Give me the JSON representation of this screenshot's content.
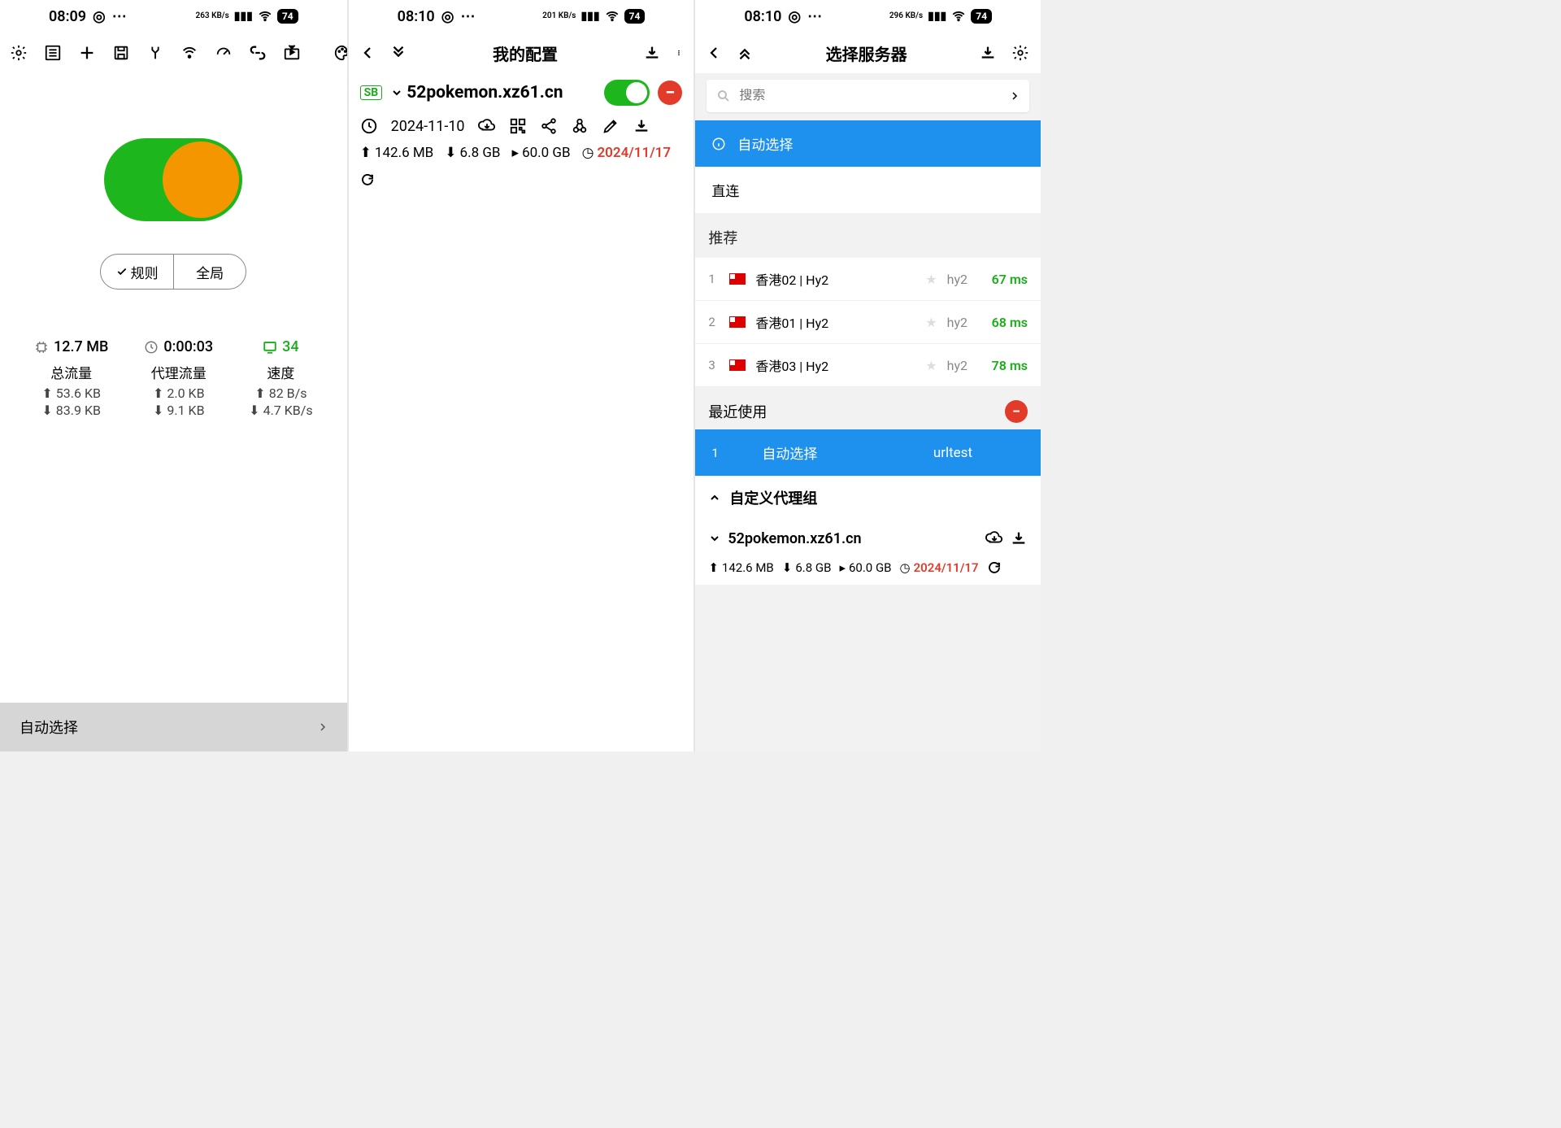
{
  "status": {
    "p1": {
      "time": "08:09",
      "speed": "263\nKB/s",
      "battery": "74"
    },
    "p2": {
      "time": "08:10",
      "speed": "201\nKB/s",
      "battery": "74"
    },
    "p3": {
      "time": "08:10",
      "speed": "296\nKB/s",
      "battery": "74"
    }
  },
  "p1": {
    "rule_label": "规则",
    "global_label": "全局",
    "mem": "12.7 MB",
    "duration": "0:00:03",
    "conns": "34",
    "total_label": "总流量",
    "proxy_label": "代理流量",
    "speed_label": "速度",
    "total_up": "53.6 KB",
    "total_down": "83.9 KB",
    "proxy_up": "2.0 KB",
    "proxy_down": "9.1 KB",
    "speed_up": "82 B/s",
    "speed_down": "4.7 KB/s",
    "bottom": "自动选择"
  },
  "p2": {
    "title": "我的配置",
    "sb": "SB",
    "name": "52pokemon.xz61.cn",
    "date": "2024-11-10",
    "up": "142.6 MB",
    "down": "6.8 GB",
    "quota": "60.0 GB",
    "expiry": "2024/11/17"
  },
  "p3": {
    "title": "选择服务器",
    "search_ph": "搜索",
    "auto": "自动选择",
    "direct": "直连",
    "rec": "推荐",
    "servers": [
      {
        "idx": "1",
        "name": "香港02 | Hy2",
        "proto": "hy2",
        "ms": "67 ms"
      },
      {
        "idx": "2",
        "name": "香港01 | Hy2",
        "proto": "hy2",
        "ms": "68 ms"
      },
      {
        "idx": "3",
        "name": "香港03 | Hy2",
        "proto": "hy2",
        "ms": "78 ms"
      }
    ],
    "recent": "最近使用",
    "recent_idx": "1",
    "recent_name": "自动选择",
    "recent_proto": "urltest",
    "custom": "自定义代理组",
    "provider": "52pokemon.xz61.cn",
    "pup": "142.6 MB",
    "pdown": "6.8 GB",
    "pquota": "60.0 GB",
    "pexpiry": "2024/11/17"
  }
}
